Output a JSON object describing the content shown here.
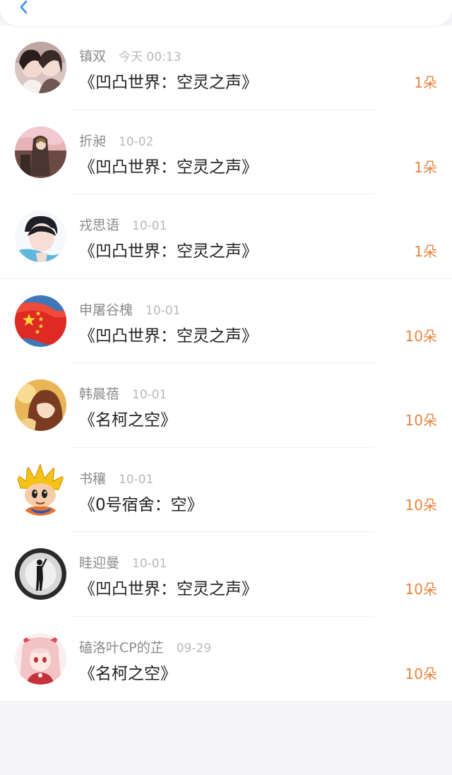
{
  "header": {
    "back_icon": "chevron-left-icon",
    "accent": "#3b8ff0"
  },
  "records": [
    {
      "name": "镇双",
      "time": "今天 00:13",
      "title": "《凹凸世界：空灵之声》",
      "count": "1朵",
      "avatar": "avatar-girls-photo"
    },
    {
      "name": "折昶",
      "time": "10-02",
      "title": "《凹凸世界：空灵之声》",
      "count": "1朵",
      "avatar": "avatar-anime-pink-sky"
    },
    {
      "name": "戎思语",
      "time": "10-01",
      "title": "《凹凸世界：空灵之声》",
      "count": "1朵",
      "avatar": "avatar-boy-photo"
    },
    {
      "name": "申屠谷槐",
      "time": "10-01",
      "title": "《凹凸世界：空灵之声》",
      "count": "10朵",
      "avatar": "avatar-flag"
    },
    {
      "name": "韩晨蓓",
      "time": "10-01",
      "title": "《名柯之空》",
      "count": "10朵",
      "avatar": "avatar-anime-girl-gold"
    },
    {
      "name": "书穰",
      "time": "10-01",
      "title": "《0号宿舍：空》",
      "count": "10朵",
      "avatar": "avatar-cartoon-spiky-hair"
    },
    {
      "name": "眭迎曼",
      "time": "10-01",
      "title": "《凹凸世界：空灵之声》",
      "count": "10朵",
      "avatar": "avatar-silhouette"
    },
    {
      "name": "磕洛叶CP的芷",
      "time": "09-29",
      "title": "《名柯之空》",
      "count": "10朵",
      "avatar": "avatar-anime-girl-pink"
    }
  ],
  "colors": {
    "count": "#e8843e",
    "name": "#8b8b8b",
    "time": "#b9b9b9",
    "title": "#222222"
  }
}
